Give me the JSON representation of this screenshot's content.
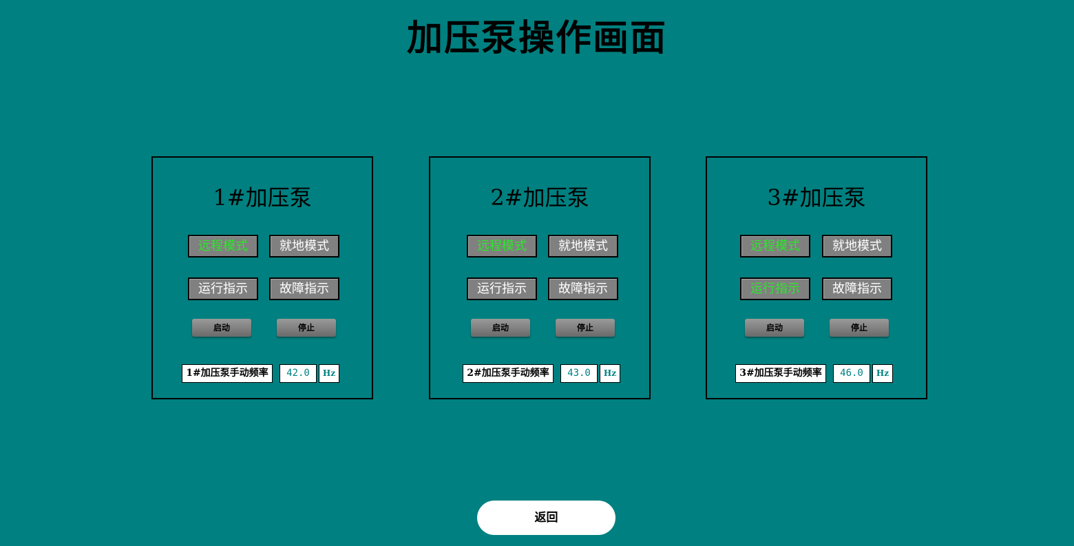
{
  "title": "加压泵操作画面",
  "pumps": [
    {
      "title": "1#加压泵",
      "remote_mode": "远程模式",
      "local_mode": "就地模式",
      "run_indicator": "运行指示",
      "fault_indicator": "故障指示",
      "start_label": "启动",
      "stop_label": "停止",
      "freq_label": "1#加压泵手动频率",
      "freq_value": "42.0",
      "freq_unit": "Hz",
      "remote_active": true,
      "running": false
    },
    {
      "title": "2#加压泵",
      "remote_mode": "远程模式",
      "local_mode": "就地模式",
      "run_indicator": "运行指示",
      "fault_indicator": "故障指示",
      "start_label": "启动",
      "stop_label": "停止",
      "freq_label": "2#加压泵手动频率",
      "freq_value": "43.0",
      "freq_unit": "Hz",
      "remote_active": true,
      "running": false
    },
    {
      "title": "3#加压泵",
      "remote_mode": "远程模式",
      "local_mode": "就地模式",
      "run_indicator": "运行指示",
      "fault_indicator": "故障指示",
      "start_label": "启动",
      "stop_label": "停止",
      "freq_label": "3#加压泵手动频率",
      "freq_value": "46.0",
      "freq_unit": "Hz",
      "remote_active": true,
      "running": true
    }
  ],
  "back_label": "返回",
  "colors": {
    "background": "#008080",
    "indicator_off": "#ffffff",
    "indicator_on": "#2de62d"
  }
}
